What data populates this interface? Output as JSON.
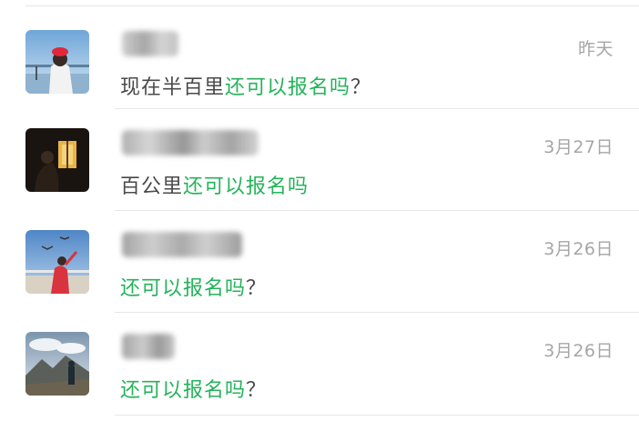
{
  "colors": {
    "highlight": "#24b35a",
    "text": "#4a4a4a",
    "date": "#a6a6a6",
    "divider": "#e6e6e6"
  },
  "conversations": [
    {
      "avatar_icon": "avatar-photo-person-red-hat",
      "date": "昨天",
      "message_prefix": "现在半百里",
      "message_highlight": "还可以报名吗",
      "message_suffix": "？"
    },
    {
      "avatar_icon": "avatar-photo-window-light",
      "date": "3月27日",
      "message_prefix": "百公里",
      "message_highlight": "还可以报名吗",
      "message_suffix": ""
    },
    {
      "avatar_icon": "avatar-photo-seagull-beach",
      "date": "3月26日",
      "message_prefix": "",
      "message_highlight": "还可以报名吗",
      "message_suffix": "？"
    },
    {
      "avatar_icon": "avatar-photo-mountain-person",
      "date": "3月26日",
      "message_prefix": "",
      "message_highlight": "还可以报名吗",
      "message_suffix": "？"
    }
  ]
}
